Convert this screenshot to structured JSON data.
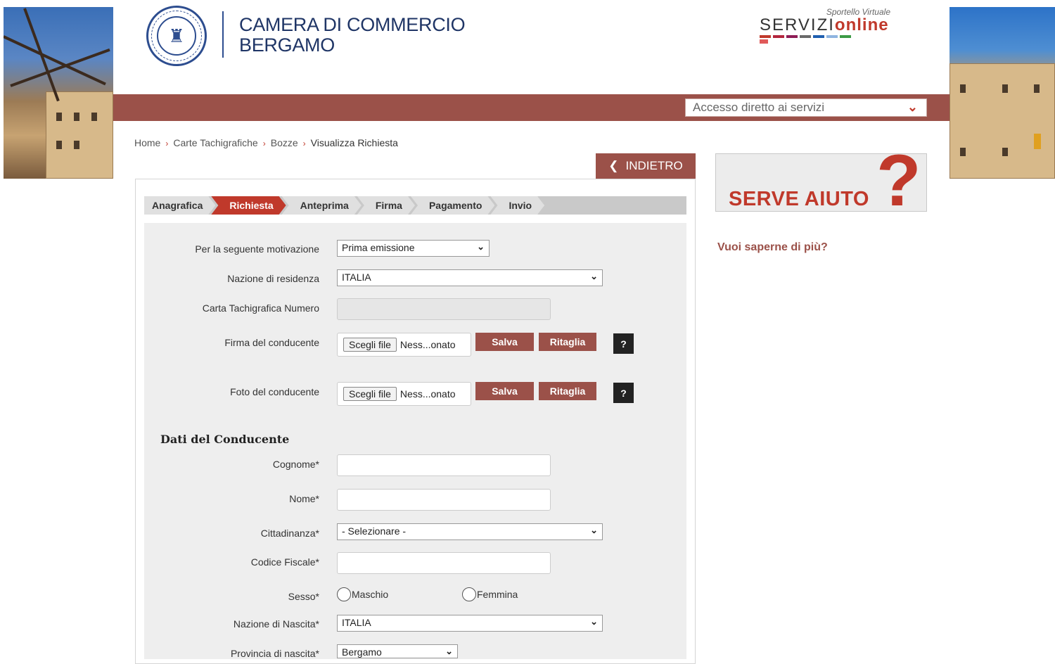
{
  "header": {
    "org_line1": "CAMERA DI COMMERCIO",
    "org_line2": "BERGAMO",
    "service_tagline": "Sportello Virtuale",
    "service_word_a": "SERVIZI",
    "service_word_b": "online",
    "quick_access": "Accesso diretto ai servizi"
  },
  "breadcrumb": [
    "Home",
    "Carte Tachigrafiche",
    "Bozze",
    "Visualizza Richiesta"
  ],
  "back_button": "INDIETRO",
  "steps": [
    "Anagrafica",
    "Richiesta",
    "Anteprima",
    "Firma",
    "Pagamento",
    "Invio"
  ],
  "active_step": "Richiesta",
  "form": {
    "motivazione_label": "Per la seguente motivazione",
    "motivazione_value": "Prima emissione",
    "nazione_res_label": "Nazione di residenza",
    "nazione_res_value": "ITALIA",
    "carta_label": "Carta Tachigrafica Numero",
    "firma_label": "Firma del conducente",
    "foto_label": "Foto del conducente",
    "file_button": "Scegli file",
    "file_none": "Ness...onato",
    "save": "Salva",
    "crop": "Ritaglia",
    "help_q": "?",
    "section_title": "Dati del Conducente",
    "cognome_label": "Cognome*",
    "nome_label": "Nome*",
    "cittadinanza_label": "Cittadinanza*",
    "cittadinanza_value": "- Selezionare -",
    "cf_label": "Codice Fiscale*",
    "sesso_label": "Sesso*",
    "sesso_m": "Maschio",
    "sesso_f": "Femmina",
    "nazione_nascita_label": "Nazione di Nascita*",
    "nazione_nascita_value": "ITALIA",
    "provincia_label": "Provincia di nascita*",
    "provincia_value": "Bergamo"
  },
  "help": {
    "card_text": "SERVE AIUTO",
    "card_mark": "?",
    "more_link": "Vuoi saperne di più?"
  },
  "colors": {
    "brand_red": "#c0392b",
    "bar_brown": "#9b5149",
    "logo_blue": "#2d4d8f"
  }
}
